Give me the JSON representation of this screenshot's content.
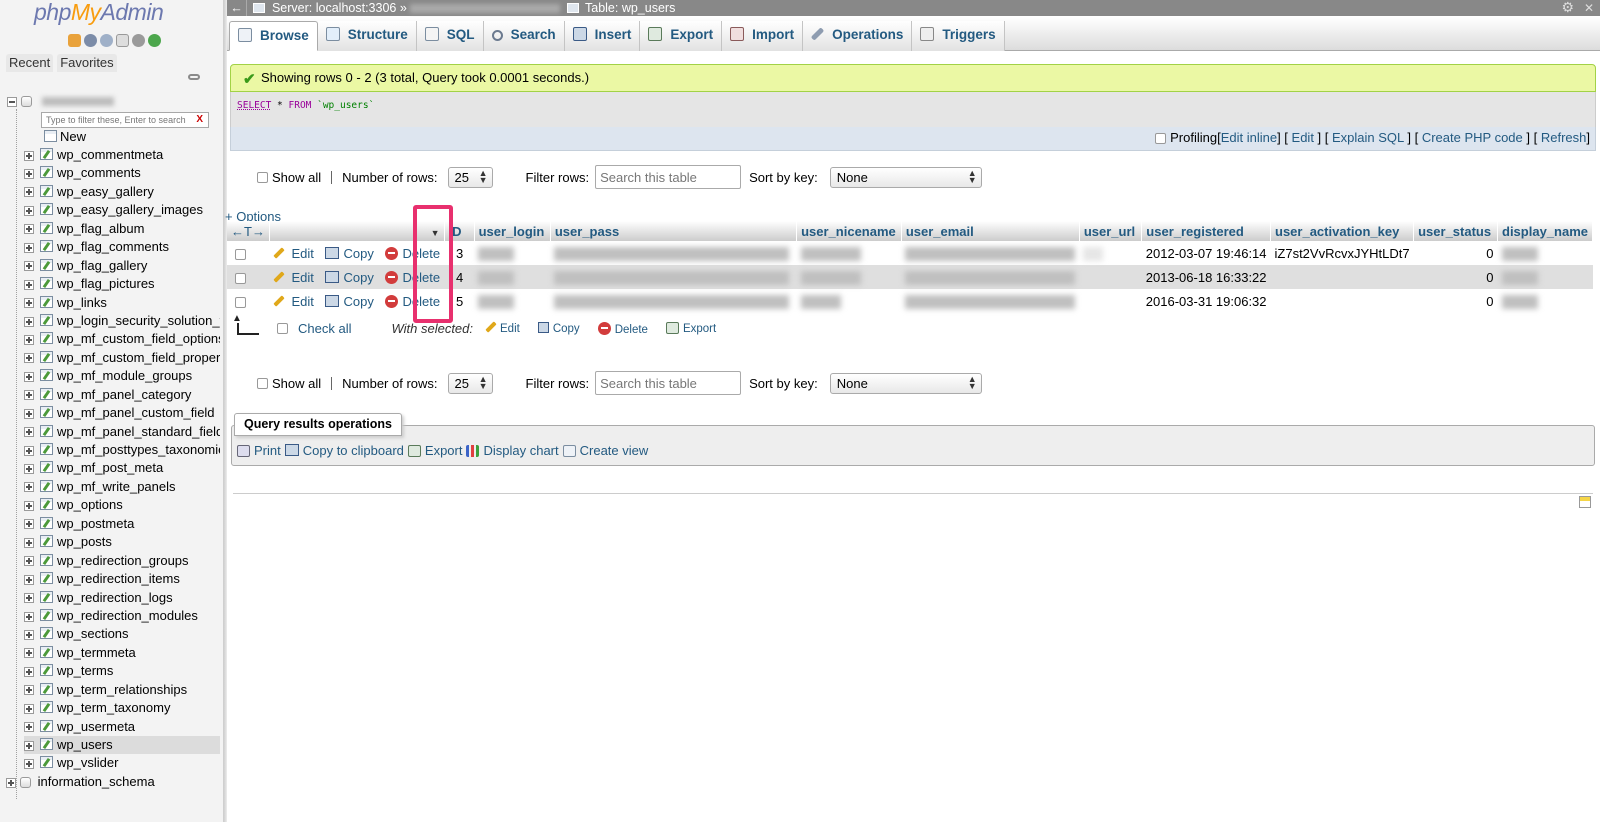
{
  "nav": {
    "logo_php": "php",
    "logo_my": "My",
    "logo_admin": "Admin",
    "tab_recent": "Recent",
    "tab_favorites": "Favorites",
    "filter_placeholder": "Type to filter these, Enter to search",
    "filter_clear": "X",
    "new_label": "New",
    "tables": [
      "wp_commentmeta",
      "wp_comments",
      "wp_easy_gallery",
      "wp_easy_gallery_images",
      "wp_flag_album",
      "wp_flag_comments",
      "wp_flag_gallery",
      "wp_flag_pictures",
      "wp_links",
      "wp_login_security_solution_fa",
      "wp_mf_custom_field_options",
      "wp_mf_custom_field_properti",
      "wp_mf_module_groups",
      "wp_mf_panel_category",
      "wp_mf_panel_custom_field",
      "wp_mf_panel_standard_field",
      "wp_mf_posttypes_taxonomies",
      "wp_mf_post_meta",
      "wp_mf_write_panels",
      "wp_options",
      "wp_postmeta",
      "wp_posts",
      "wp_redirection_groups",
      "wp_redirection_items",
      "wp_redirection_logs",
      "wp_redirection_modules",
      "wp_sections",
      "wp_termmeta",
      "wp_terms",
      "wp_term_relationships",
      "wp_term_taxonomy",
      "wp_usermeta",
      "wp_users",
      "wp_vslider"
    ],
    "info_schema": "information_schema"
  },
  "topbar": {
    "back": "←",
    "server": "Server: localhost:3306 »",
    "table": "Table: wp_users",
    "gear": "⚙",
    "close": "✕"
  },
  "tabs": [
    {
      "label": "Browse"
    },
    {
      "label": "Structure"
    },
    {
      "label": "SQL"
    },
    {
      "label": "Search"
    },
    {
      "label": "Insert"
    },
    {
      "label": "Export"
    },
    {
      "label": "Import"
    },
    {
      "label": "Operations"
    },
    {
      "label": "Triggers"
    }
  ],
  "message": {
    "check": "✔",
    "text": "Showing rows 0 - 2 (3 total, Query took 0.0001 seconds.)"
  },
  "sql": {
    "select": "SELECT",
    "star": " * ",
    "from": "FROM",
    "table": " `wp_users`"
  },
  "sqltools": {
    "profiling": "Profiling",
    "edit_inline": "Edit inline",
    "edit": "Edit",
    "explain": "Explain SQL",
    "create_php": "Create PHP code",
    "refresh": "Refresh"
  },
  "navbar": {
    "show_all": "Show all",
    "number_of_rows": "Number of rows:",
    "rows_value": "25",
    "filter_rows": "Filter rows:",
    "search_placeholder": "Search this table",
    "sort_by_key": "Sort by key:",
    "sort_value": "None"
  },
  "options_link": "+ Options",
  "arrows": "←T→",
  "columns": [
    "ID",
    "user_login",
    "user_pass",
    "user_nicename",
    "user_email",
    "user_url",
    "user_registered",
    "user_activation_key",
    "user_status",
    "display_name"
  ],
  "row_actions": {
    "edit": "Edit",
    "copy": "Copy",
    "delete": "Delete"
  },
  "rows": [
    {
      "id": "3",
      "user_registered": "2012-03-07 19:46:14",
      "user_activation_key": "iZ7st2VvRcvxJYHtLDt7",
      "user_status": "0"
    },
    {
      "id": "4",
      "user_registered": "2013-06-18 16:33:22",
      "user_activation_key": "",
      "user_status": "0"
    },
    {
      "id": "5",
      "user_registered": "2016-03-31 19:06:32",
      "user_activation_key": "",
      "user_status": "0"
    }
  ],
  "with_selected": {
    "check_all": "Check all",
    "label": "With selected:",
    "edit": "Edit",
    "copy": "Copy",
    "delete": "Delete",
    "export": "Export"
  },
  "qro": {
    "legend": "Query results operations",
    "print": "Print",
    "copy": "Copy to clipboard",
    "export": "Export",
    "chart": "Display chart",
    "view": "Create view"
  },
  "colors": {
    "link": "#235a81",
    "success_bg": "#ebf8a4",
    "highlight": "#e8306e"
  }
}
